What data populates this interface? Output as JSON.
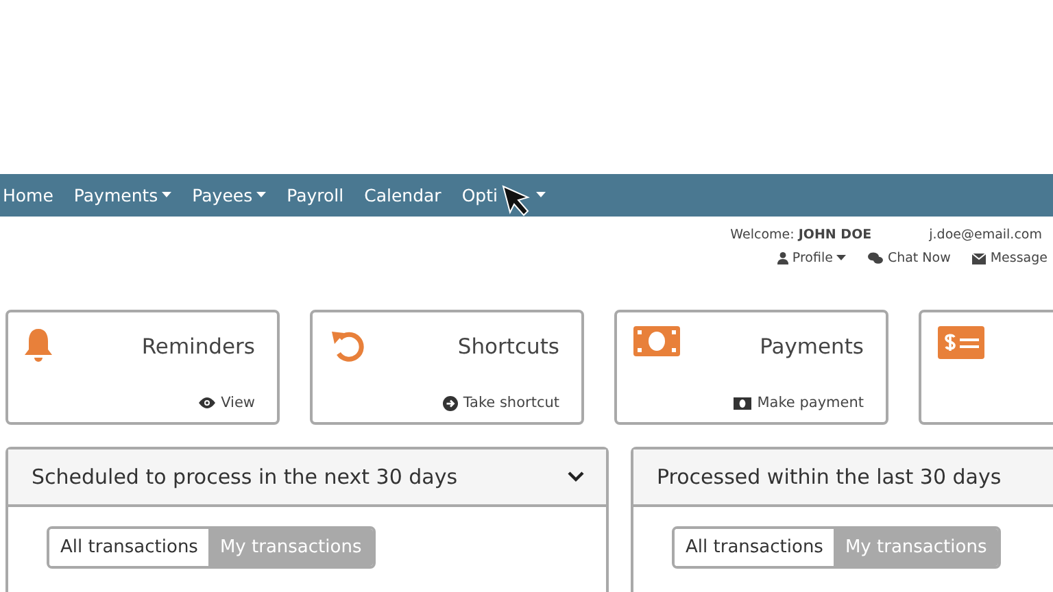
{
  "nav": {
    "items": [
      {
        "label": "Home",
        "dropdown": false
      },
      {
        "label": "Payments",
        "dropdown": true
      },
      {
        "label": "Payees",
        "dropdown": true
      },
      {
        "label": "Payroll",
        "dropdown": false
      },
      {
        "label": "Calendar",
        "dropdown": false
      },
      {
        "label": "Opti",
        "dropdown": true,
        "cursor": true
      }
    ]
  },
  "user": {
    "welcome": "Welcome:",
    "name": "JOHN DOE",
    "email": "j.doe@email.com",
    "links": [
      {
        "kind": "profile",
        "label": "Profile"
      },
      {
        "kind": "chat",
        "label": "Chat Now"
      },
      {
        "kind": "message",
        "label": "Message"
      }
    ]
  },
  "cards": [
    {
      "kind": "bell",
      "title": "Reminders",
      "action": "View"
    },
    {
      "kind": "undo",
      "title": "Shortcuts",
      "action": "Take shortcut"
    },
    {
      "kind": "money",
      "title": "Payments",
      "action": "Make payment"
    },
    {
      "kind": "bill"
    }
  ],
  "panels": [
    {
      "title": "Scheduled to process in the next 30 days",
      "collapsible": true,
      "tabs": [
        {
          "label": "All transactions",
          "selected": false
        },
        {
          "label": "My transactions",
          "selected": true
        }
      ]
    },
    {
      "title": "Processed within the last 30 days",
      "collapsible": false,
      "tabs": [
        {
          "label": "All transactions",
          "selected": false
        },
        {
          "label": "My transactions",
          "selected": true
        }
      ]
    }
  ]
}
